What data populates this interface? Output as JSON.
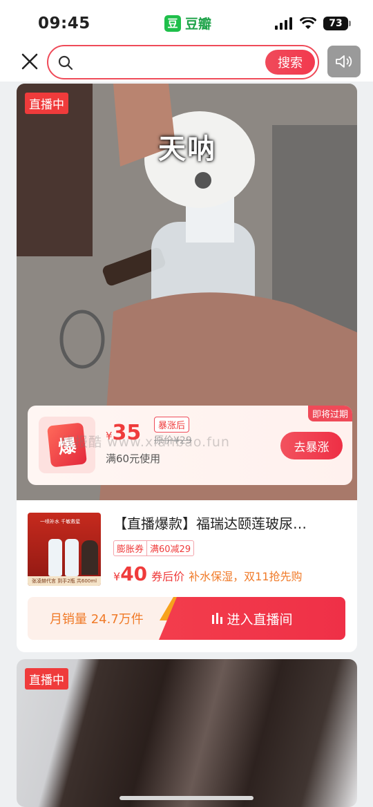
{
  "status": {
    "time": "09:45",
    "app_name": "豆瓣",
    "app_icon_text": "豆",
    "battery": "73"
  },
  "topbar": {
    "search_placeholder": "",
    "search_button": "搜索"
  },
  "card1": {
    "live_tag": "直播中",
    "video_caption": "天呐",
    "coupon": {
      "expire_tag": "即将过期",
      "icon_text": "爆",
      "price_currency": "¥",
      "price": "35",
      "surge_badge": "暴涨后",
      "strike_price": "原价¥29",
      "condition": "满60元使用",
      "watermark": "线报酷 www.xianbao.fun",
      "button": "去暴涨"
    },
    "product": {
      "thumb_caption": "一喷补水 千敏救星",
      "thumb_footer": "张凌赫代言 到手2瓶 共600ml",
      "title": "【直播爆款】福瑞达颐莲玻尿…",
      "tags": [
        "膨胀券",
        "满60减29"
      ],
      "price_currency": "¥",
      "price": "40",
      "price_suffix": "券后价",
      "desc": "补水保湿，双11抢先购",
      "sales": "月销量 24.7万件",
      "enter_button": "进入直播间"
    }
  },
  "card2": {
    "live_tag": "直播中"
  },
  "colors": {
    "accent": "#ef3b3b",
    "orange": "#f07a28",
    "app_green": "#1fbf4a"
  }
}
